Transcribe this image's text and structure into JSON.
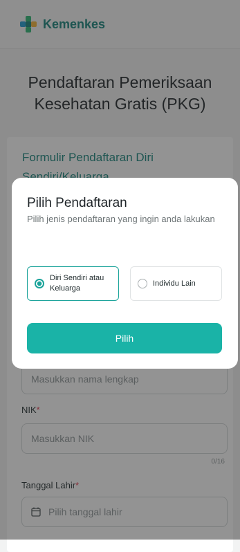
{
  "header": {
    "brand": "Kemenkes"
  },
  "page": {
    "title": "Pendaftaran Pemeriksaan Kesehatan Gratis (PKG)"
  },
  "form": {
    "title": "Formulir Pendaftaran Diri Sendiri/Keluarga",
    "name_placeholder": "Masukkan nama lengkap",
    "nik_label": "NIK",
    "nik_placeholder": "Masukkan NIK",
    "nik_counter": "0/16",
    "dob_label": "Tanggal Lahir",
    "dob_placeholder": "Pilih tanggal lahir",
    "required_mark": "*"
  },
  "modal": {
    "title": "Pilih Pendaftaran",
    "subtitle": "Pilih jenis pendaftaran yang ingin anda lakukan",
    "options": [
      {
        "label": "Diri Sendiri atau Keluarga",
        "selected": true
      },
      {
        "label": "Individu Lain",
        "selected": false
      }
    ],
    "button_label": "Pilih"
  },
  "colors": {
    "brand": "#14837b",
    "accent": "#1ab3a7",
    "required": "#e0394f"
  }
}
